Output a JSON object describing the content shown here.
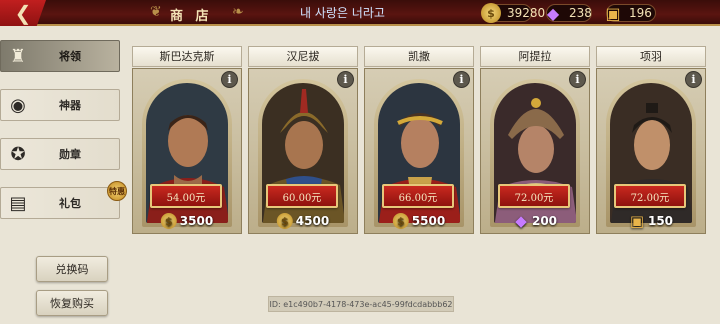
{
  "topbar": {
    "back_icon": "back-arrow-icon",
    "title": "商 店",
    "marquee": "내 사랑은 너라고",
    "currencies": [
      {
        "icon": "coin-icon",
        "value": "39280"
      },
      {
        "icon": "gem-icon",
        "value": "238"
      },
      {
        "icon": "chest-icon",
        "value": "196"
      }
    ]
  },
  "sidebar": {
    "items": [
      {
        "label": "将领",
        "icon": "spartan-helmet-icon",
        "active": true
      },
      {
        "label": "神器",
        "icon": "eye-of-horus-icon",
        "active": false
      },
      {
        "label": "勋章",
        "icon": "eagle-medal-icon",
        "active": false
      },
      {
        "label": "礼包",
        "icon": "gift-chest-icon",
        "active": false,
        "badge": "特惠"
      }
    ],
    "redeem_label": "兑换码",
    "restore_label": "恢复购买"
  },
  "heroes": [
    {
      "name": "斯巴达克斯",
      "price": "3500",
      "price_icon": "coin-icon",
      "buy": "54.00元"
    },
    {
      "name": "汉尼拔",
      "price": "4500",
      "price_icon": "coin-icon",
      "buy": "60.00元"
    },
    {
      "name": "凯撒",
      "price": "5500",
      "price_icon": "coin-icon",
      "buy": "66.00元"
    },
    {
      "name": "阿提拉",
      "price": "200",
      "price_icon": "gem-icon",
      "buy": "72.00元"
    },
    {
      "name": "项羽",
      "price": "150",
      "price_icon": "chest-icon",
      "buy": "72.00元"
    }
  ],
  "info_label": "i",
  "device_id": "ID: e1c490b7-4178-473e-ac45-99fdcdabbb62",
  "colors": {
    "accent_red": "#b71c1c",
    "gold": "#e7c77a",
    "bg": "#e9e4d6"
  }
}
